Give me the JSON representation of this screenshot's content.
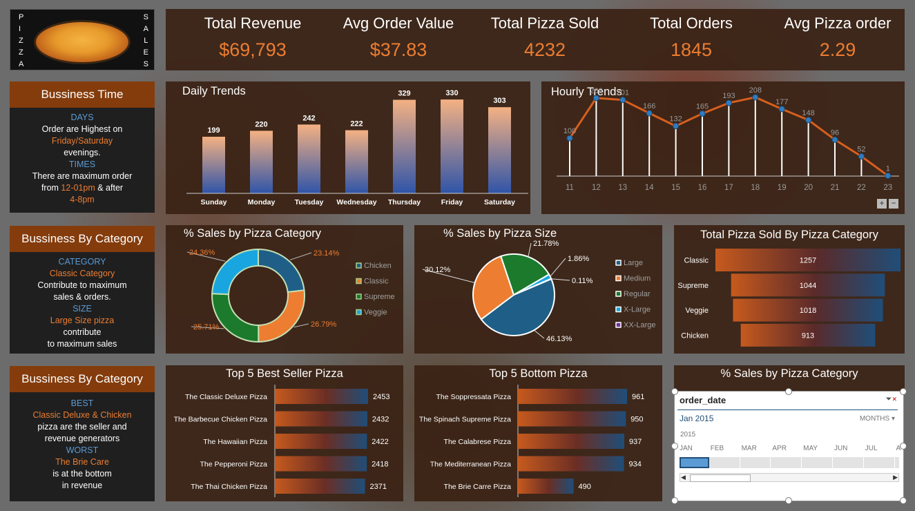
{
  "brand": {
    "left_letters": [
      "P",
      "I",
      "Z",
      "Z",
      "A"
    ],
    "right_letters": [
      "S",
      "A",
      "L",
      "E",
      "S"
    ]
  },
  "kpis": [
    {
      "label": "Total Revenue",
      "value": "$69,793"
    },
    {
      "label": "Avg Order Value",
      "value": "$37.83"
    },
    {
      "label": "Total Pizza Sold",
      "value": "4232"
    },
    {
      "label": "Total Orders",
      "value": "1845"
    },
    {
      "label": "Avg Pizza order",
      "value": "2.29"
    }
  ],
  "side1": {
    "title": "Bussiness Time",
    "days_h": "DAYS",
    "l1": "Order are Highest on",
    "l2": "Friday/Saturday",
    "l3": "evenings.",
    "times_h": "TIMES",
    "l4": "There are maximum order",
    "l5a": "from ",
    "l5b": "12-01pm",
    "l5c": " & after",
    "l6": "4-8pm"
  },
  "side2": {
    "title": "Bussiness By Category",
    "cat_h": "CATEGORY",
    "l1": "Classic Category",
    "l2": "Contribute to maximum",
    "l3": "sales & orders.",
    "size_h": "SIZE",
    "l4": "Large Size pizza",
    "l5": "contribute",
    "l6": "to maximum sales"
  },
  "side3": {
    "title": "Bussiness By Category",
    "best_h": "BEST",
    "l1": "Classic Deluxe & Chicken",
    "l2": "pizza are the seller and",
    "l3": "revenue generators",
    "worst_h": "WORST",
    "l4": "The Brie Care",
    "l5": "is at the bottom",
    "l6": "in revenue"
  },
  "titles": {
    "daily": "Daily Trends",
    "hourly": "Hourly Trends",
    "cat_pct": "% Sales by Pizza Category",
    "size_pct": "% Sales by Pizza Size",
    "cat_total": "Total Pizza Sold By Pizza Category",
    "top5": "Top 5 Best Seller Pizza",
    "bottom5": "Top 5 Bottom Pizza",
    "slicer_panel": "% Sales by Pizza Category"
  },
  "zoom": {
    "plus": "+",
    "minus": "−"
  },
  "slicer": {
    "field": "order_date",
    "selected": "Jan 2015",
    "level": "MONTHS",
    "year": "2015",
    "months": [
      "JAN",
      "FEB",
      "MAR",
      "APR",
      "MAY",
      "JUN",
      "JUL",
      "A"
    ],
    "selected_index": 0
  },
  "chart_data": [
    {
      "id": "daily",
      "type": "bar",
      "title": "Daily Trends",
      "categories": [
        "Sunday",
        "Monday",
        "Tuesday",
        "Wednesday",
        "Thursday",
        "Friday",
        "Saturday"
      ],
      "values": [
        199,
        220,
        242,
        222,
        329,
        330,
        303
      ]
    },
    {
      "id": "hourly",
      "type": "line",
      "title": "Hourly Trends",
      "x": [
        "11",
        "12",
        "13",
        "14",
        "15",
        "16",
        "17",
        "18",
        "19",
        "20",
        "21",
        "22",
        "23"
      ],
      "values": [
        100,
        206,
        201,
        166,
        132,
        165,
        193,
        208,
        177,
        148,
        96,
        52,
        1
      ]
    },
    {
      "id": "cat_pct",
      "type": "pie",
      "title": "% Sales by Pizza Category",
      "categories": [
        "Chicken",
        "Classic",
        "Supreme",
        "Veggie"
      ],
      "slice_order": [
        "Chicken",
        "Classic",
        "Supreme",
        "Veggie"
      ],
      "values": [
        23.14,
        26.79,
        25.71,
        24.36
      ],
      "labels": [
        "23.14%",
        "26.79%",
        "25.71%",
        "24.36%"
      ],
      "colors": [
        "#1f5f87",
        "#ed7d31",
        "#1b7a2c",
        "#19a6e0"
      ]
    },
    {
      "id": "size_pct",
      "type": "pie",
      "title": "% Sales by Pizza Size",
      "categories": [
        "Large",
        "Medium",
        "Regular",
        "X-Large",
        "XX-Large"
      ],
      "values": [
        46.13,
        30.12,
        21.78,
        1.86,
        0.11
      ],
      "labels": [
        "46.13%",
        "30.12%",
        "21.78%",
        "1.86%",
        "0.11%"
      ],
      "colors": [
        "#1f5f87",
        "#ed7d31",
        "#1b7a2c",
        "#19a6e0",
        "#7030a0"
      ]
    },
    {
      "id": "cat_total",
      "type": "bar",
      "title": "Total Pizza Sold By Pizza Category",
      "categories": [
        "Classic",
        "Supreme",
        "Veggie",
        "Chicken"
      ],
      "values": [
        1257,
        1044,
        1018,
        913
      ]
    },
    {
      "id": "top5",
      "type": "bar",
      "title": "Top 5 Best Seller Pizza",
      "categories": [
        "The Classic Deluxe Pizza",
        "The Barbecue Chicken Pizza",
        "The Hawaiian Pizza",
        "The Pepperoni Pizza",
        "The Thai Chicken Pizza"
      ],
      "values": [
        2453,
        2432,
        2422,
        2418,
        2371
      ]
    },
    {
      "id": "bottom5",
      "type": "bar",
      "title": "Top 5 Bottom Pizza",
      "categories": [
        "The Soppressata Pizza",
        "The Spinach Supreme Pizza",
        "The Calabrese Pizza",
        "The Mediterranean Pizza",
        "The Brie Carre Pizza"
      ],
      "values": [
        961,
        950,
        937,
        934,
        490
      ]
    }
  ]
}
